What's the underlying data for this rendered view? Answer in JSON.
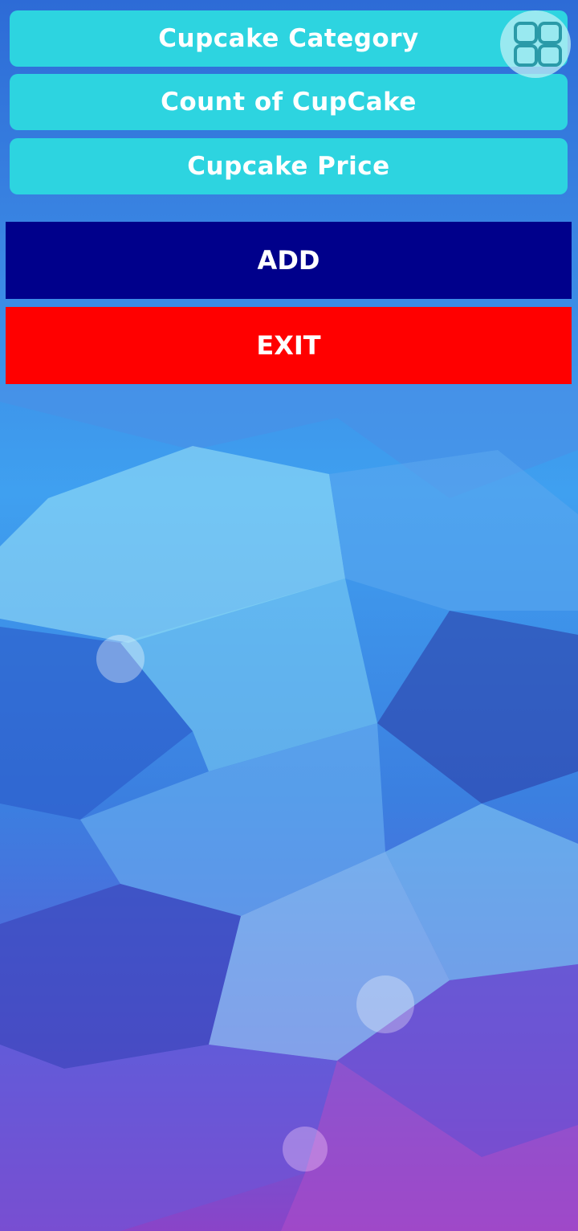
{
  "form": {
    "category_placeholder": "Cupcake Category",
    "count_placeholder": "Count of CupCake",
    "price_placeholder": "Cupcake Price"
  },
  "actions": {
    "add_label": "ADD",
    "exit_label": "EXIT"
  },
  "floating_button": {
    "icon": "apps-grid-icon"
  },
  "colors": {
    "field_bg": "#2dd4e0",
    "add_bg": "#00008b",
    "exit_bg": "#ff0000",
    "text": "#ffffff"
  }
}
